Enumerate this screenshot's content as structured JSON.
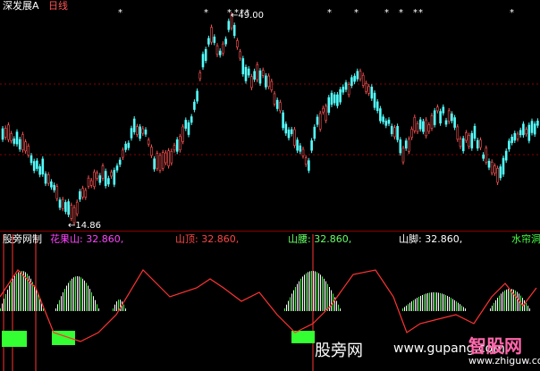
{
  "header": {
    "title": "深发展A",
    "period": "日线",
    "high_label": "←49.00",
    "low_label": "←14.86"
  },
  "indicator": {
    "name": "股旁网制",
    "items": [
      {
        "label": "花果山:",
        "value": "32.860,",
        "color": "#ff44ff"
      },
      {
        "label": "山顶:",
        "value": "32.860,",
        "color": "#ff4444"
      },
      {
        "label": "山腰:",
        "value": "32.860,",
        "color": "#66ff66"
      },
      {
        "label": "山脚:",
        "value": "32.860,",
        "color": "#ffffff"
      },
      {
        "label": "水帘洞",
        "value": "",
        "color": "#44ff44"
      }
    ]
  },
  "markers": {
    "symbol": "*"
  },
  "watermark": {
    "text1": "股旁网",
    "text2": "www.gupang.com",
    "text3": "智股网",
    "text4": "www.zhiguw.com"
  },
  "colors": {
    "up": "#ff5555",
    "down": "#54ffff",
    "grid": "#8b0000",
    "line": "#ff3333",
    "bar_light": "#ffffff",
    "bar_green": "#33ff33"
  }
}
